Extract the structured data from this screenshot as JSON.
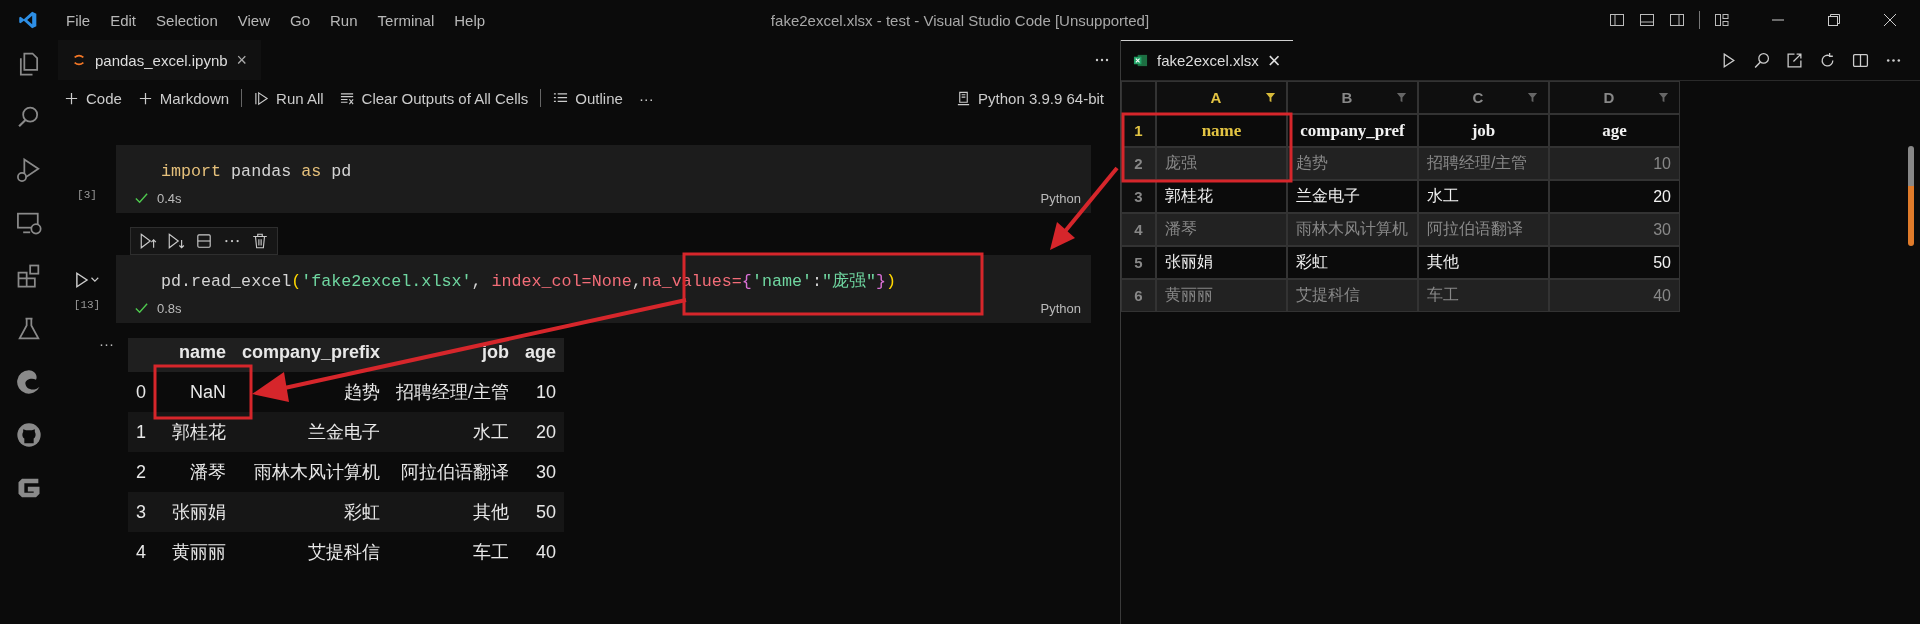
{
  "window": {
    "title": "fake2excel.xlsx - test - Visual Studio Code [Unsupported]",
    "menu": [
      "File",
      "Edit",
      "Selection",
      "View",
      "Go",
      "Run",
      "Terminal",
      "Help"
    ]
  },
  "notebook": {
    "tab": {
      "label": "pandas_excel.ipynb",
      "close": "×"
    },
    "toolbar": [
      {
        "kind": "plus",
        "label": "Code"
      },
      {
        "kind": "plus",
        "label": "Markdown"
      },
      {
        "kind": "run",
        "label": "Run All"
      },
      {
        "kind": "clear",
        "label": "Clear Outputs of All Cells"
      },
      {
        "kind": "outline",
        "label": "Outline"
      },
      {
        "kind": "more",
        "label": "···"
      }
    ],
    "kernel": "Python 3.9.9 64-bit",
    "cells": [
      {
        "count": "[3]",
        "time": "0.4s",
        "language": "Python",
        "tokens": [
          {
            "kind": "keyword",
            "text": "import"
          },
          {
            "kind": "plain",
            "text": " pandas "
          },
          {
            "kind": "keyword",
            "text": "as"
          },
          {
            "kind": "plain",
            "text": " pd"
          }
        ]
      },
      {
        "count": "[13]",
        "time": "0.8s",
        "language": "Python",
        "tokens": [
          {
            "kind": "plain",
            "text": "pd.read_excel"
          },
          {
            "kind": "bracket1",
            "text": "("
          },
          {
            "kind": "string",
            "text": "'fake2excel.xlsx'"
          },
          {
            "kind": "plain",
            "text": ", "
          },
          {
            "kind": "param",
            "text": "index_col=None"
          },
          {
            "kind": "plain",
            "text": ","
          },
          {
            "kind": "param",
            "text": "na_values="
          },
          {
            "kind": "bracket2",
            "text": "{"
          },
          {
            "kind": "string",
            "text": "'name'"
          },
          {
            "kind": "plain",
            "text": ":"
          },
          {
            "kind": "string",
            "text": "\"庞强\""
          },
          {
            "kind": "bracket2",
            "text": "}"
          },
          {
            "kind": "bracket1",
            "text": ")"
          }
        ]
      }
    ],
    "output": {
      "more": "···",
      "columns": [
        "",
        "name",
        "company_prefix",
        "job",
        "age"
      ],
      "rows": [
        [
          "0",
          "NaN",
          "趋势",
          "招聘经理/主管",
          "10"
        ],
        [
          "1",
          "郭桂花",
          "兰金电子",
          "水工",
          "20"
        ],
        [
          "2",
          "潘琴",
          "雨林木风计算机",
          "阿拉伯语翻译",
          "30"
        ],
        [
          "3",
          "张丽娟",
          "彩虹",
          "其他",
          "50"
        ],
        [
          "4",
          "黄丽丽",
          "艾提科信",
          "车工",
          "40"
        ]
      ]
    }
  },
  "spreadsheet": {
    "tab": {
      "label": "fake2excel.xlsx",
      "close": "×"
    },
    "columns": [
      {
        "label": "A",
        "selected": true
      },
      {
        "label": "B",
        "selected": false
      },
      {
        "label": "C",
        "selected": false
      },
      {
        "label": "D",
        "selected": false
      }
    ],
    "rows": [
      {
        "number": "1",
        "selected": true,
        "cells": [
          "name",
          "company_pref",
          "job",
          "age"
        ]
      },
      {
        "number": "2",
        "selected": false,
        "cells": [
          "庞强",
          "趋势",
          "招聘经理/主管",
          "10"
        ]
      },
      {
        "number": "3",
        "selected": false,
        "cells": [
          "郭桂花",
          "兰金电子",
          "水工",
          "20"
        ]
      },
      {
        "number": "4",
        "selected": false,
        "cells": [
          "潘琴",
          "雨林木风计算机",
          "阿拉伯语翻译",
          "30"
        ]
      },
      {
        "number": "5",
        "selected": false,
        "cells": [
          "张丽娟",
          "彩虹",
          "其他",
          "50"
        ]
      },
      {
        "number": "6",
        "selected": false,
        "cells": [
          "黄丽丽",
          "艾提科信",
          "车工",
          "40"
        ]
      }
    ]
  }
}
